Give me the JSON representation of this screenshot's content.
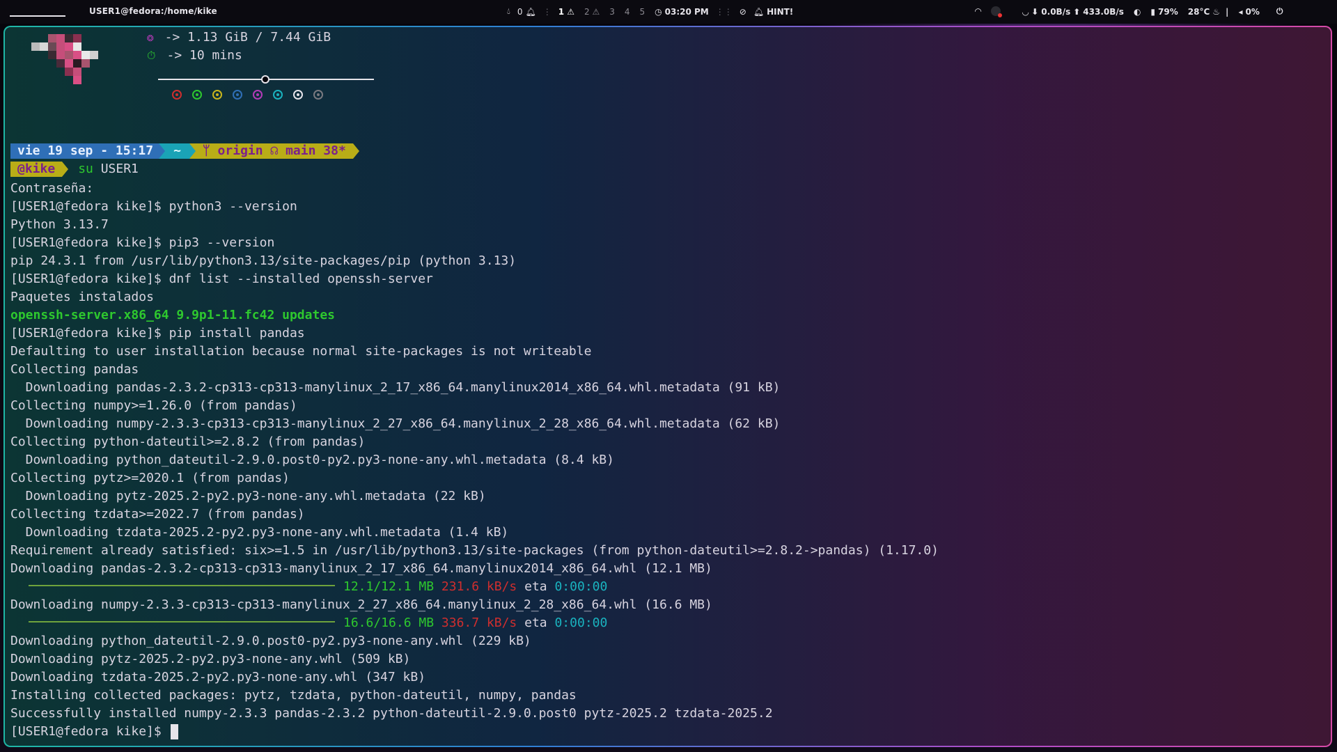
{
  "topbar": {
    "window_title": "USER1@fedora:/home/kike",
    "notif_count": "0",
    "workspaces": [
      "1",
      "2",
      "3",
      "4",
      "5"
    ],
    "clock": "03:20 PM",
    "hint": "HINT!",
    "net_down": "0.0B/s",
    "net_up": "433.0B/s",
    "battery": "79%",
    "temp": "28°C",
    "volume": "0%"
  },
  "fetch": {
    "memory": "-> 1.13 GiB / 7.44 GiB",
    "uptime": "-> 10 mins",
    "swatch_colors": [
      "#cf2e2e",
      "#2ec82e",
      "#c9b61c",
      "#2f6fb7",
      "#b43bb8",
      "#1ab3bf",
      "#e6e4ea",
      "#7a7a80"
    ]
  },
  "prompt": {
    "date": "vie 19 sep - 15:17",
    "tilde": "~",
    "git": "ᛘ origin ☊ main 38*",
    "user": "@kike",
    "cmd": "su USER1"
  },
  "terminal": {
    "lines": [
      "Contraseña:",
      "[USER1@fedora kike]$ python3 --version",
      "Python 3.13.7",
      "[USER1@fedora kike]$ pip3 --version",
      "pip 24.3.1 from /usr/lib/python3.13/site-packages/pip (python 3.13)",
      "[USER1@fedora kike]$ dnf list --installed openssh-server",
      "Paquetes instalados",
      "openssh-server.x86_64 9.9p1-11.fc42 updates",
      "[USER1@fedora kike]$ pip install pandas",
      "Defaulting to user installation because normal site-packages is not writeable",
      "Collecting pandas",
      "  Downloading pandas-2.3.2-cp313-cp313-manylinux_2_17_x86_64.manylinux2014_x86_64.whl.metadata (91 kB)",
      "Collecting numpy>=1.26.0 (from pandas)",
      "  Downloading numpy-2.3.3-cp313-cp313-manylinux_2_27_x86_64.manylinux_2_28_x86_64.whl.metadata (62 kB)",
      "Collecting python-dateutil>=2.8.2 (from pandas)",
      "  Downloading python_dateutil-2.9.0.post0-py2.py3-none-any.whl.metadata (8.4 kB)",
      "Collecting pytz>=2020.1 (from pandas)",
      "  Downloading pytz-2025.2-py2.py3-none-any.whl.metadata (22 kB)",
      "Collecting tzdata>=2022.7 (from pandas)",
      "  Downloading tzdata-2025.2-py2.py3-none-any.whl.metadata (1.4 kB)",
      "Requirement already satisfied: six>=1.5 in /usr/lib/python3.13/site-packages (from python-dateutil>=2.8.2->pandas) (1.17.0)",
      "Downloading pandas-2.3.2-cp313-cp313-manylinux_2_17_x86_64.manylinux2014_x86_64.whl (12.1 MB)",
      "",
      "Downloading numpy-2.3.3-cp313-cp313-manylinux_2_27_x86_64.manylinux_2_28_x86_64.whl (16.6 MB)",
      "",
      "Downloading python_dateutil-2.9.0.post0-py2.py3-none-any.whl (229 kB)",
      "Downloading pytz-2025.2-py2.py3-none-any.whl (509 kB)",
      "Downloading tzdata-2025.2-py2.py3-none-any.whl (347 kB)",
      "Installing collected packages: pytz, tzdata, python-dateutil, numpy, pandas",
      "Successfully installed numpy-2.3.3 pandas-2.3.2 python-dateutil-2.9.0.post0 pytz-2025.2 tzdata-2025.2"
    ],
    "progress1": {
      "size": "12.1/12.1 MB",
      "speed": "231.6 kB/s",
      "eta_label": "eta",
      "eta": "0:00:00"
    },
    "progress2": {
      "size": "16.6/16.6 MB",
      "speed": "336.7 kB/s",
      "eta_label": "eta",
      "eta": "0:00:00"
    },
    "final_prompt": "[USER1@fedora kike]$ "
  }
}
